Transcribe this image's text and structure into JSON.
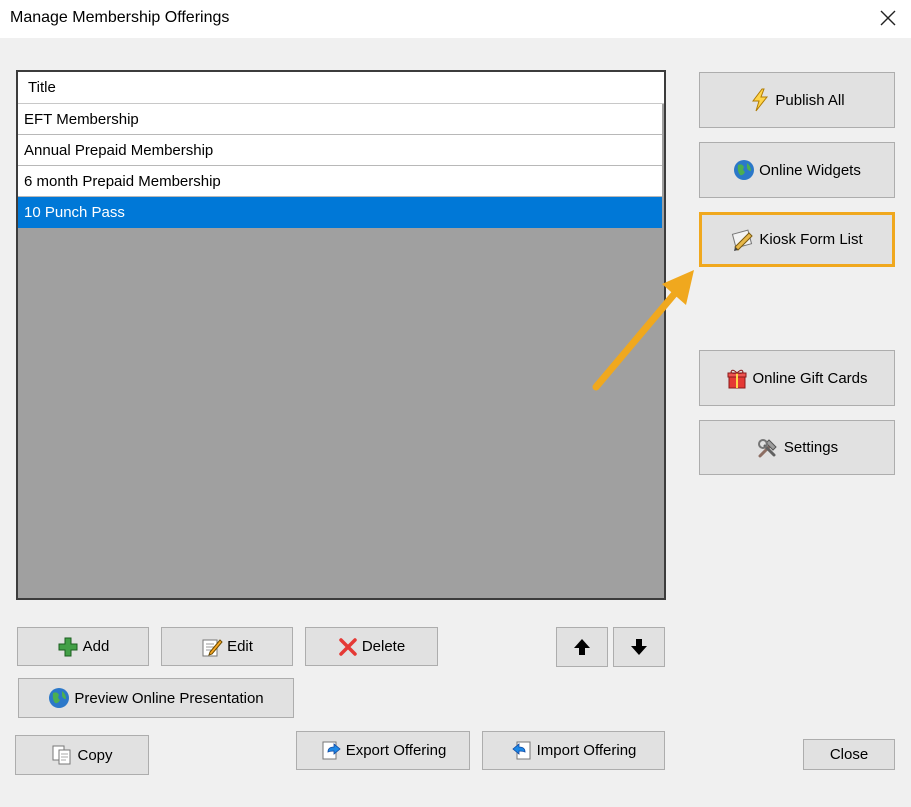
{
  "window": {
    "title": "Manage Membership Offerings"
  },
  "grid": {
    "header": "Title",
    "rows": [
      {
        "label": "EFT Membership",
        "selected": false
      },
      {
        "label": "Annual Prepaid Membership",
        "selected": false
      },
      {
        "label": "6 month Prepaid Membership",
        "selected": false
      },
      {
        "label": "10 Punch Pass",
        "selected": true
      }
    ]
  },
  "side_buttons": {
    "publish_all": "Publish All",
    "online_widgets": "Online Widgets",
    "kiosk_form_list": "Kiosk Form List",
    "online_gift_cards": "Online Gift Cards",
    "settings": "Settings"
  },
  "bottom_buttons": {
    "add": "Add",
    "edit": "Edit",
    "delete": "Delete",
    "preview": "Preview Online Presentation",
    "copy": "Copy",
    "export": "Export Offering",
    "import": "Import Offering",
    "close": "Close"
  },
  "colors": {
    "selection": "#0078d7",
    "highlight": "#f0a81e",
    "grid_background": "#a0a0a0"
  },
  "icons": {
    "publish_all": "lightning-icon",
    "online_widgets": "globe-icon",
    "kiosk_form_list": "pencil-icon",
    "online_gift_cards": "gift-icon",
    "settings": "tools-icon",
    "add": "plus-icon",
    "edit": "edit-icon",
    "delete": "x-icon",
    "preview": "globe-icon",
    "copy": "copy-icon",
    "export": "export-icon",
    "import": "import-icon",
    "move_up": "arrow-up-icon",
    "move_down": "arrow-down-icon",
    "close_window": "close-icon"
  }
}
